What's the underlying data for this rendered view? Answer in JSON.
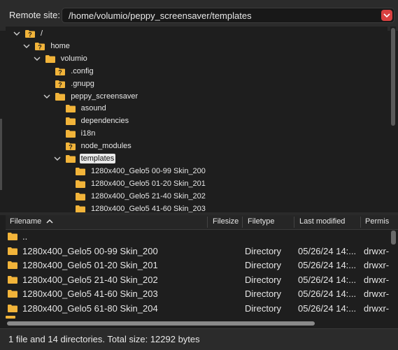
{
  "remote_site": {
    "label": "Remote site:",
    "path": "/home/volumio/peppy_screensaver/templates",
    "accent": "#d84040"
  },
  "tree": {
    "nodes": [
      {
        "label": "/",
        "depth": 0,
        "expanded": true,
        "icon": "unknown-folder-icon"
      },
      {
        "label": "home",
        "depth": 1,
        "expanded": true,
        "icon": "unknown-folder-icon"
      },
      {
        "label": "volumio",
        "depth": 2,
        "expanded": true,
        "icon": "folder-icon"
      },
      {
        "label": ".config",
        "depth": 3,
        "expanded": null,
        "icon": "unknown-folder-icon"
      },
      {
        "label": ".gnupg",
        "depth": 3,
        "expanded": null,
        "icon": "unknown-folder-icon"
      },
      {
        "label": "peppy_screensaver",
        "depth": 3,
        "expanded": true,
        "icon": "folder-icon"
      },
      {
        "label": "asound",
        "depth": 4,
        "expanded": null,
        "icon": "folder-icon"
      },
      {
        "label": "dependencies",
        "depth": 4,
        "expanded": null,
        "icon": "folder-icon"
      },
      {
        "label": "i18n",
        "depth": 4,
        "expanded": null,
        "icon": "folder-icon"
      },
      {
        "label": "node_modules",
        "depth": 4,
        "expanded": null,
        "icon": "unknown-folder-icon"
      },
      {
        "label": "templates",
        "depth": 4,
        "expanded": true,
        "icon": "folder-icon",
        "selected": true
      },
      {
        "label": "1280x400_Gelo5 00-99 Skin_200",
        "depth": 5,
        "expanded": null,
        "icon": "folder-icon"
      },
      {
        "label": "1280x400_Gelo5 01-20 Skin_201",
        "depth": 5,
        "expanded": null,
        "icon": "folder-icon"
      },
      {
        "label": "1280x400_Gelo5 21-40 Skin_202",
        "depth": 5,
        "expanded": null,
        "icon": "folder-icon"
      },
      {
        "label": "1280x400_Gelo5 41-60 Skin_203",
        "depth": 5,
        "expanded": null,
        "icon": "folder-icon"
      }
    ]
  },
  "list": {
    "columns": {
      "filename": "Filename",
      "filesize": "Filesize",
      "filetype": "Filetype",
      "last_modified": "Last modified",
      "permissions": "Permis"
    },
    "rows": [
      {
        "name": "..",
        "type": "",
        "modified": "",
        "perm": ""
      },
      {
        "name": "1280x400_Gelo5 00-99 Skin_200",
        "type": "Directory",
        "modified": "05/26/24 14:...",
        "perm": "drwxr-"
      },
      {
        "name": "1280x400_Gelo5 01-20 Skin_201",
        "type": "Directory",
        "modified": "05/26/24 14:...",
        "perm": "drwxr-"
      },
      {
        "name": "1280x400_Gelo5 21-40 Skin_202",
        "type": "Directory",
        "modified": "05/26/24 14:...",
        "perm": "drwxr-"
      },
      {
        "name": "1280x400_Gelo5 41-60 Skin_203",
        "type": "Directory",
        "modified": "05/26/24 14:...",
        "perm": "drwxr-"
      },
      {
        "name": "1280x400_Gelo5 61-80 Skin_204",
        "type": "Directory",
        "modified": "05/26/24 14:...",
        "perm": "drwxr-"
      }
    ]
  },
  "status": {
    "text": "1 file and 14 directories. Total size: 12292 bytes"
  },
  "colors": {
    "folder": "#f2b43a",
    "selection": "#e9e9e9"
  }
}
